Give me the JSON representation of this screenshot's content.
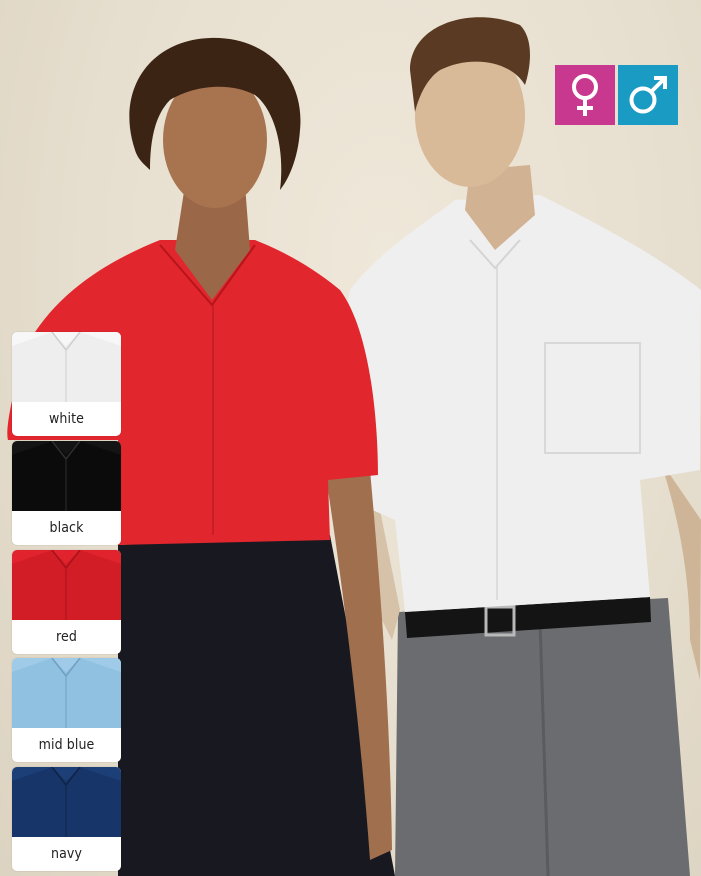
{
  "badges": {
    "female": {
      "icon": "female-symbol-icon",
      "color": "#c8388f"
    },
    "male": {
      "icon": "male-symbol-icon",
      "color": "#1a9bc4"
    }
  },
  "swatches": [
    {
      "label": "white",
      "color": "#f7f7f7",
      "shade": "#e2e2e2"
    },
    {
      "label": "black",
      "color": "#141414",
      "shade": "#050505"
    },
    {
      "label": "red",
      "color": "#e0232c",
      "shade": "#b8141c"
    },
    {
      "label": "mid blue",
      "color": "#9fcbe8",
      "shade": "#7eb2d6"
    },
    {
      "label": "navy",
      "color": "#1d3f78",
      "shade": "#122a54"
    }
  ]
}
